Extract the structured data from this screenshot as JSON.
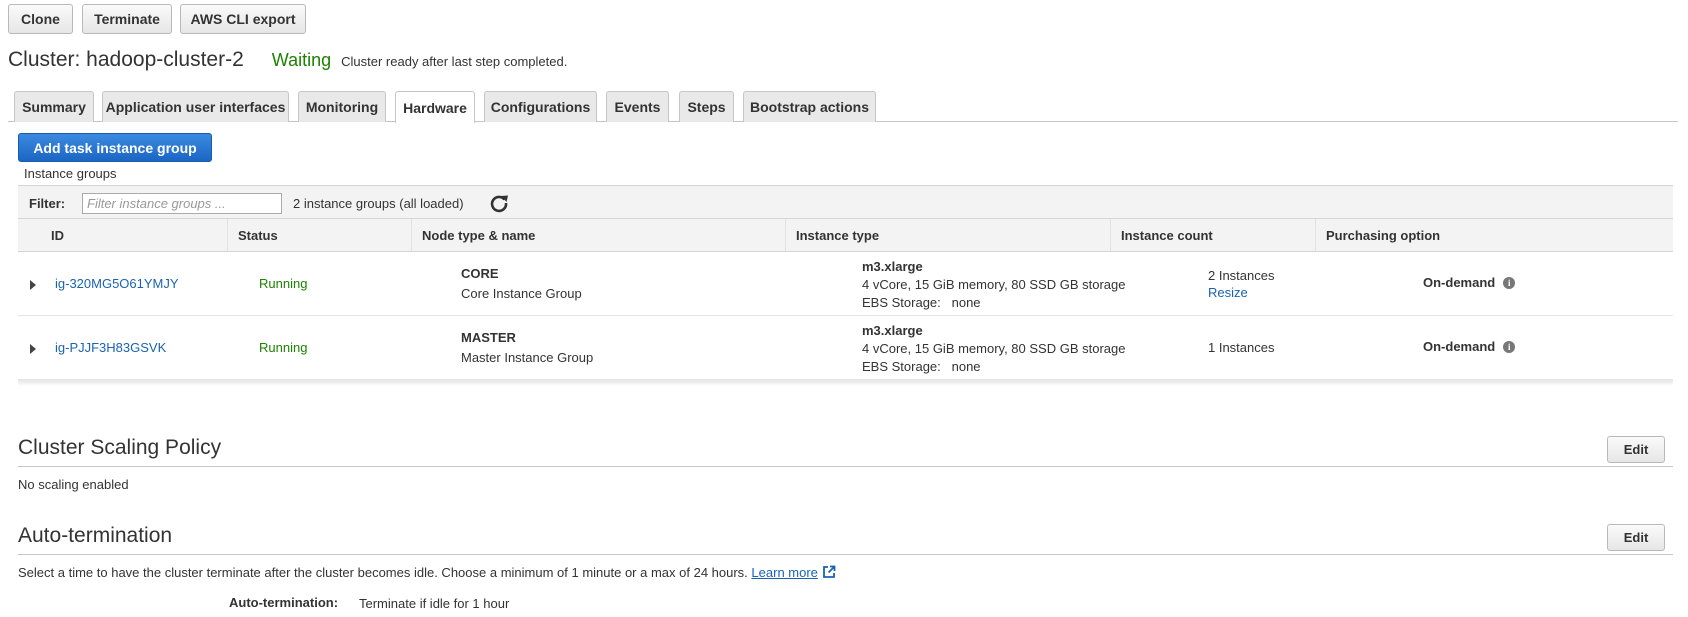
{
  "toolbar": {
    "clone": "Clone",
    "terminate": "Terminate",
    "aws_cli_export": "AWS CLI export"
  },
  "cluster": {
    "title": "Cluster: hadoop-cluster-2",
    "state": "Waiting",
    "state_description": "Cluster ready after last step completed."
  },
  "tabs": [
    {
      "label": "Summary"
    },
    {
      "label": "Application user interfaces"
    },
    {
      "label": "Monitoring"
    },
    {
      "label": "Hardware",
      "active": true
    },
    {
      "label": "Configurations"
    },
    {
      "label": "Events"
    },
    {
      "label": "Steps"
    },
    {
      "label": "Bootstrap actions"
    }
  ],
  "hardware": {
    "add_button": "Add task instance group",
    "caption": "Instance groups",
    "filter": {
      "label": "Filter:",
      "placeholder": "Filter instance groups ...",
      "value": "",
      "count_text": "2 instance groups (all loaded)"
    },
    "columns": [
      "ID",
      "Status",
      "Node type & name",
      "Instance type",
      "Instance count",
      "Purchasing option"
    ],
    "rows": [
      {
        "id": "ig-320MG5O61YMJY",
        "status": "Running",
        "node_type": "CORE",
        "node_name": "Core Instance Group",
        "instance_type": "m3.xlarge",
        "instance_spec": "4 vCore, 15 GiB memory, 80 SSD GB storage",
        "ebs": "EBS Storage:   none",
        "count": "2 Instances",
        "resize": "Resize",
        "purchasing": "On-demand"
      },
      {
        "id": "ig-PJJF3H83GSVK",
        "status": "Running",
        "node_type": "MASTER",
        "node_name": "Master Instance Group",
        "instance_type": "m3.xlarge",
        "instance_spec": "4 vCore, 15 GiB memory, 80 SSD GB storage",
        "ebs": "EBS Storage:   none",
        "count": "1 Instances",
        "purchasing": "On-demand"
      }
    ]
  },
  "scaling": {
    "title": "Cluster Scaling Policy",
    "edit": "Edit",
    "text": "No scaling enabled"
  },
  "autotermination": {
    "title": "Auto-termination",
    "edit": "Edit",
    "description": "Select a time to have the cluster terminate after the cluster becomes idle. Choose a minimum of 1 minute or a max of 24 hours.",
    "learn_more": "Learn more",
    "field_label": "Auto-termination:",
    "field_value": "Terminate if idle for 1 hour"
  },
  "colors": {
    "accent": "#1c66c4",
    "link": "#1a63b2",
    "success": "#1d8102"
  }
}
